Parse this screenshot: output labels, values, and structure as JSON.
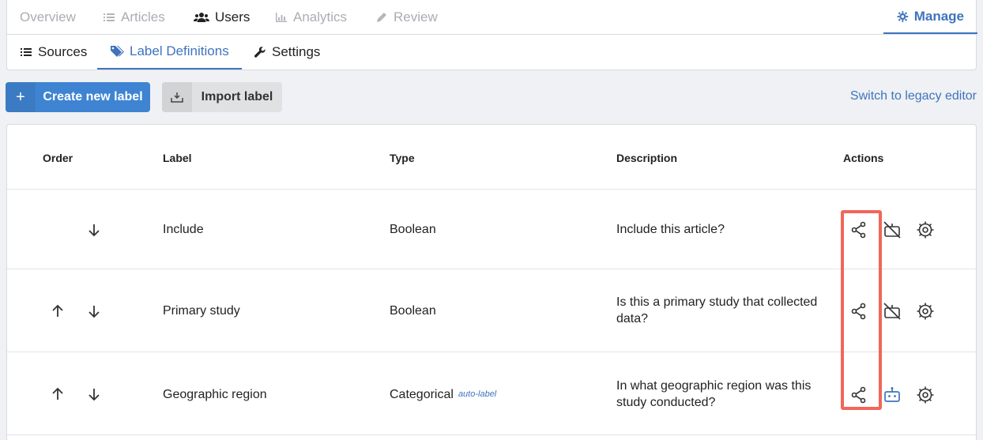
{
  "nav": {
    "tabs": [
      {
        "label": "Overview"
      },
      {
        "label": "Articles",
        "icon": "list-icon"
      },
      {
        "label": "Users",
        "icon": "users-icon"
      },
      {
        "label": "Analytics",
        "icon": "chart-icon"
      },
      {
        "label": "Review",
        "icon": "pencil-icon"
      },
      {
        "label": "Manage",
        "icon": "gear-icon"
      }
    ],
    "active": "Manage"
  },
  "subnav": {
    "tabs": [
      {
        "label": "Sources",
        "icon": "list-icon"
      },
      {
        "label": "Label Definitions",
        "icon": "tags-icon"
      },
      {
        "label": "Settings",
        "icon": "wrench-icon"
      }
    ],
    "active": "Label Definitions"
  },
  "toolbar": {
    "create_label": "Create new label",
    "import_label": "Import label",
    "legacy_link": "Switch to legacy editor"
  },
  "table": {
    "headers": {
      "order": "Order",
      "label": "Label",
      "type": "Type",
      "description": "Description",
      "actions": "Actions"
    },
    "rows": [
      {
        "label": "Include",
        "type": "Boolean",
        "badge": "",
        "description": [
          "Include this article?"
        ],
        "auto_label": false,
        "up": false
      },
      {
        "label": "Primary study",
        "type": "Boolean",
        "badge": "",
        "description": [
          "Is this a primary study that collected",
          "data?"
        ],
        "auto_label": false,
        "up": true
      },
      {
        "label": "Geographic region",
        "type": "Categorical",
        "badge": "auto-label",
        "description": [
          "In what geographic region was this",
          "study conducted?"
        ],
        "auto_label": true,
        "up": true
      }
    ]
  },
  "colors": {
    "accent": "#3f74bd",
    "highlight": "#f0675a",
    "primary_button": "#3f84d2"
  }
}
